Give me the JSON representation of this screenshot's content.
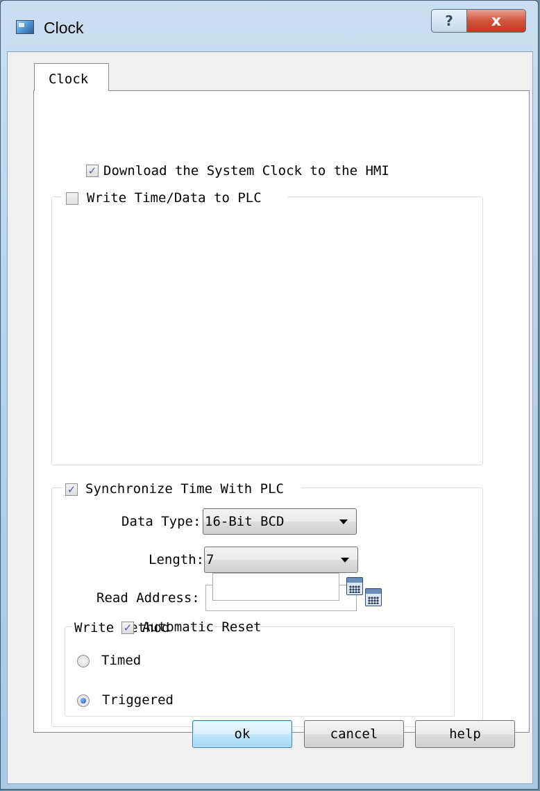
{
  "window": {
    "title": "Clock",
    "help_glyph": "?",
    "close_glyph": "x"
  },
  "tabs": [
    {
      "label": "Clock",
      "selected": true
    }
  ],
  "download_clock": {
    "label": "Download the System Clock to the HMI",
    "checked": true,
    "check_glyph": "✓"
  },
  "write_time": {
    "label": "Write Time/Data to PLC",
    "checked": false
  },
  "sync": {
    "label": "Synchronize Time With PLC",
    "checked": true,
    "check_glyph": "✓",
    "data_type": {
      "label": "Data Type:",
      "value": "16-Bit BCD"
    },
    "length": {
      "label": "Length:",
      "value": "7"
    },
    "read_address": {
      "label": "Read Address:",
      "value": ""
    },
    "write_method": {
      "legend": "Write Method",
      "timed": {
        "label": "Timed",
        "selected": false
      },
      "triggered": {
        "label": "Triggered",
        "selected": true,
        "value": ""
      },
      "auto_reset": {
        "label": "Automatic Reset",
        "checked": true,
        "check_glyph": "✓"
      }
    }
  },
  "buttons": {
    "ok": "ok",
    "cancel": "cancel",
    "help": "help"
  },
  "colors": {
    "titlebar": "#b8d3ea",
    "close_button": "#c94a30",
    "default_button_border": "#3c7fb1",
    "client_bg": "#f0f0f0"
  },
  "icons": [
    "window-icon",
    "help-icon",
    "close-icon",
    "calculator-icon"
  ]
}
